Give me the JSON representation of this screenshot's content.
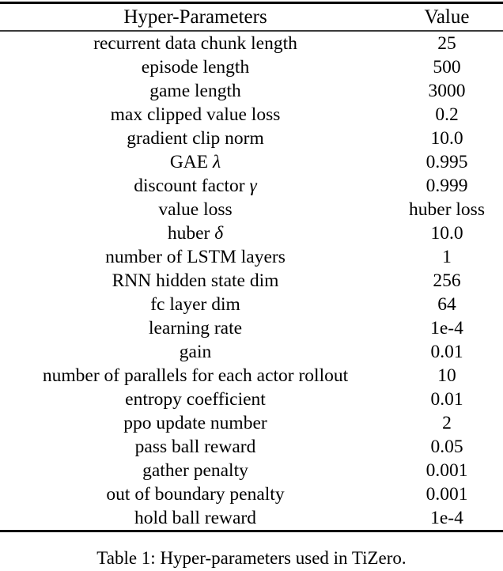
{
  "table": {
    "columns": [
      "Hyper-Parameters",
      "Value"
    ],
    "rows": [
      {
        "param": "recurrent data chunk length",
        "value": "25"
      },
      {
        "param": "episode length",
        "value": "500"
      },
      {
        "param": "game length",
        "value": "3000"
      },
      {
        "param": "max clipped value loss",
        "value": "0.2"
      },
      {
        "param": "gradient clip norm",
        "value": "10.0"
      },
      {
        "param": "GAE λ",
        "value": "0.995"
      },
      {
        "param": "discount factor γ",
        "value": "0.999"
      },
      {
        "param": "value loss",
        "value": "huber loss"
      },
      {
        "param": "huber δ",
        "value": "10.0"
      },
      {
        "param": "number of LSTM layers",
        "value": "1"
      },
      {
        "param": "RNN hidden state dim",
        "value": "256"
      },
      {
        "param": "fc layer dim",
        "value": "64"
      },
      {
        "param": "learning rate",
        "value": "1e-4"
      },
      {
        "param": "gain",
        "value": "0.01"
      },
      {
        "param": "number of parallels for each actor rollout",
        "value": "10"
      },
      {
        "param": "entropy coefficient",
        "value": "0.01"
      },
      {
        "param": "ppo update number",
        "value": "2"
      },
      {
        "param": "pass ball reward",
        "value": "0.05"
      },
      {
        "param": "gather penalty",
        "value": "0.001"
      },
      {
        "param": "out of boundary penalty",
        "value": "0.001"
      },
      {
        "param": "hold ball reward",
        "value": "1e-4"
      }
    ]
  },
  "caption": "Table 1: Hyper-parameters used in TiZero.",
  "colors": {
    "text": "#000000",
    "rule_heavy": "#000000",
    "rule_light": "#3a3a3a",
    "background": "#ffffff"
  }
}
